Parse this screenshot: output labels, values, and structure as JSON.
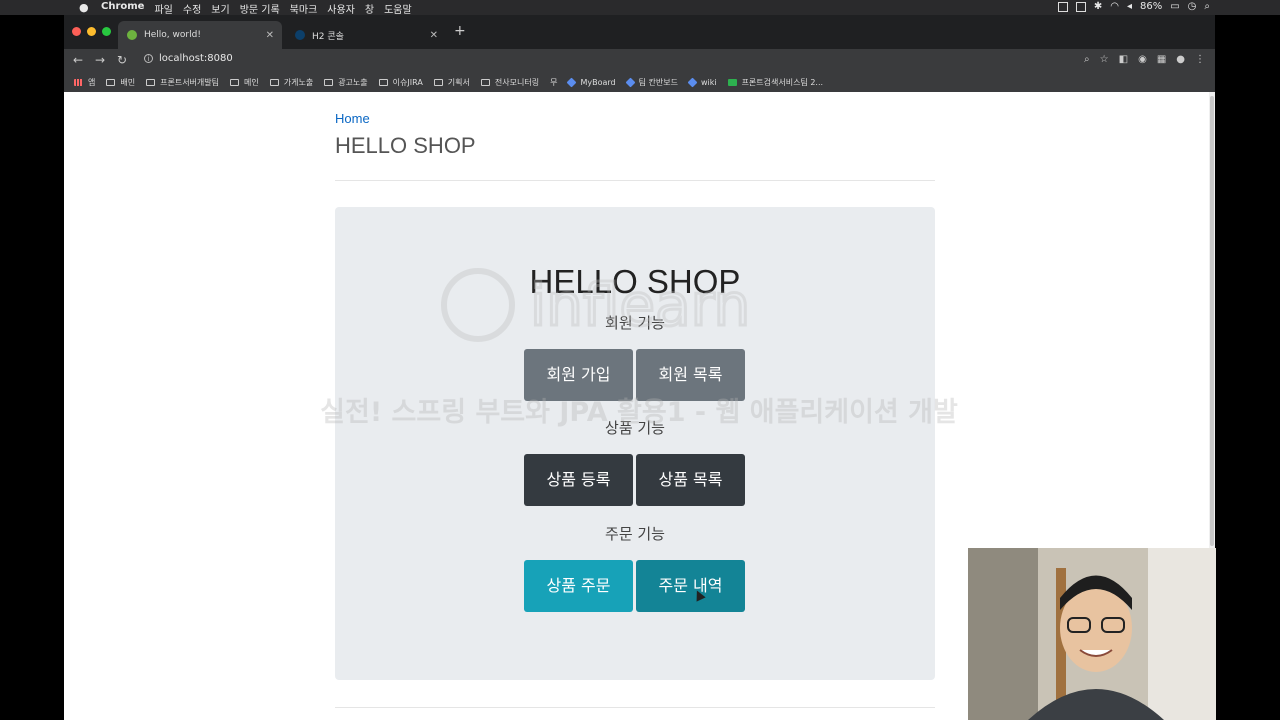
{
  "macos": {
    "app_name": "Chrome",
    "menus": [
      "파일",
      "수정",
      "보기",
      "방문 기록",
      "북마크",
      "사용자",
      "창",
      "도움말"
    ],
    "battery": "86%"
  },
  "browser": {
    "tabs": [
      {
        "title": "Hello, world!",
        "active": true
      },
      {
        "title": "H2 콘솔",
        "active": false
      }
    ],
    "url": "localhost:8080",
    "bookmarks": [
      "앱",
      "배민",
      "프론트서버개발팀",
      "메인",
      "가게노출",
      "광고노출",
      "이슈JIRA",
      "기획서",
      "전사모니터링",
      "무",
      "MyBoard",
      "팀 칸반보드",
      "wiki",
      "프론트검색서비스팀 2..."
    ]
  },
  "page": {
    "home_link": "Home",
    "site_title": "HELLO SHOP",
    "jumbotron_title": "HELLO SHOP",
    "sections": [
      {
        "label": "회원 기능",
        "buttons": [
          "회원 가입",
          "회원 목록"
        ],
        "style": "secondary"
      },
      {
        "label": "상품 기능",
        "buttons": [
          "상품 등록",
          "상품 목록"
        ],
        "style": "dark"
      },
      {
        "label": "주문 기능",
        "buttons": [
          "상품 주문",
          "주문 내역"
        ],
        "style": "info"
      }
    ]
  },
  "overlay": {
    "watermark_line": "실전! 스프링 부트와 JPA 활용1 - 웹 애플리케이션 개발",
    "watermark_logo": "inflearn"
  },
  "colors": {
    "secondary": "#6c757d",
    "dark": "#343a40",
    "info": "#17a2b8",
    "link": "#0a67c4",
    "jumbotron_bg": "#e9ecef"
  }
}
